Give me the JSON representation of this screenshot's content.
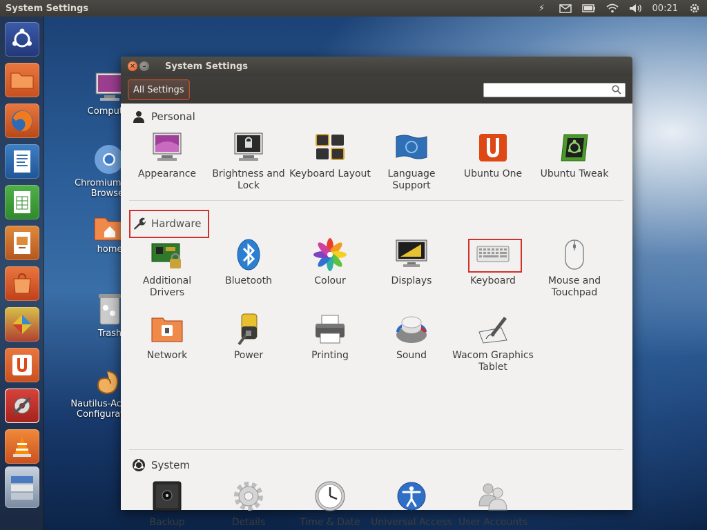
{
  "top_panel": {
    "app_title": "System Settings",
    "clock": "00:21"
  },
  "desktop": {
    "icons": [
      {
        "label": "Computer"
      },
      {
        "label": "Chromium Web Browser"
      },
      {
        "label": "home"
      },
      {
        "label": "Trash"
      },
      {
        "label": "Nautilus-Actions Configuration"
      }
    ]
  },
  "window": {
    "title": "System Settings",
    "all_settings_label": "All Settings",
    "search": {
      "value": "",
      "placeholder": ""
    }
  },
  "sections": {
    "personal": {
      "title": "Personal",
      "items": [
        {
          "label": "Appearance"
        },
        {
          "label": "Brightness and Lock"
        },
        {
          "label": "Keyboard Layout"
        },
        {
          "label": "Language Support"
        },
        {
          "label": "Ubuntu One"
        },
        {
          "label": "Ubuntu Tweak"
        }
      ]
    },
    "hardware": {
      "title": "Hardware",
      "items": [
        {
          "label": "Additional Drivers"
        },
        {
          "label": "Bluetooth"
        },
        {
          "label": "Colour"
        },
        {
          "label": "Displays"
        },
        {
          "label": "Keyboard"
        },
        {
          "label": "Mouse and Touchpad"
        },
        {
          "label": "Network"
        },
        {
          "label": "Power"
        },
        {
          "label": "Printing"
        },
        {
          "label": "Sound"
        },
        {
          "label": "Wacom Graphics Tablet"
        }
      ]
    },
    "system": {
      "title": "System",
      "items": [
        {
          "label": "Backup"
        },
        {
          "label": "Details"
        },
        {
          "label": "Time & Date"
        },
        {
          "label": "Universal Access"
        },
        {
          "label": "User Accounts"
        }
      ]
    }
  },
  "colors": {
    "accent": "#dd4814",
    "highlight_box": "#d0312d",
    "panel": "#3c3b37"
  }
}
